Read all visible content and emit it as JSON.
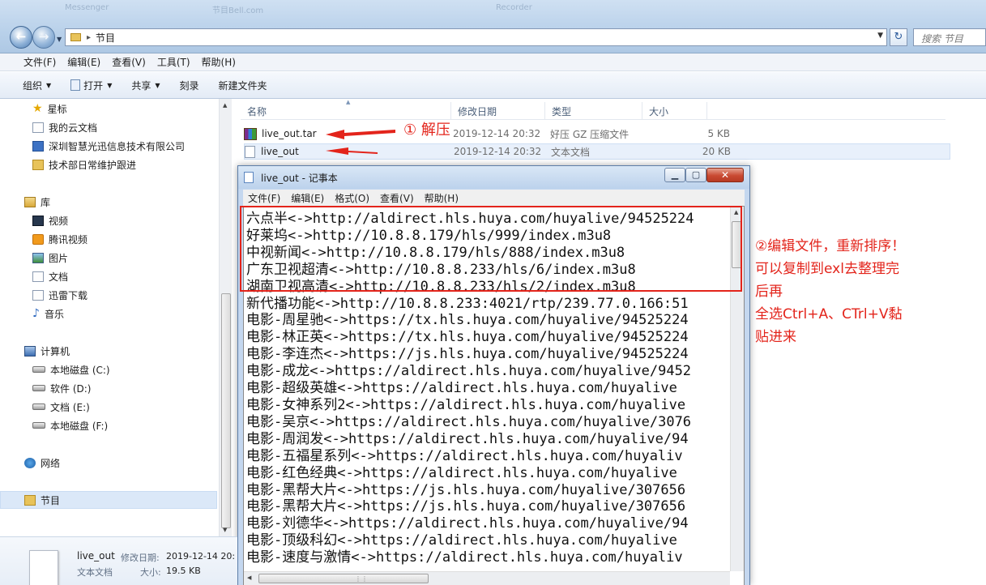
{
  "window": {
    "ghost_titles": [
      "Messenger",
      "节目Bell.com",
      "Recorder"
    ],
    "address": {
      "crumb": "节目"
    },
    "search_placeholder": "搜索 节目"
  },
  "menu": [
    "文件(F)",
    "编辑(E)",
    "查看(V)",
    "工具(T)",
    "帮助(H)"
  ],
  "toolbar": {
    "organize": "组织",
    "open": "打开",
    "share": "共享",
    "burn": "刻录",
    "new_folder": "新建文件夹"
  },
  "nav": {
    "favorites": "星标",
    "cloud_docs": "我的云文档",
    "company": "深圳智慧光迅信息技术有限公司",
    "tech_log": "技术部日常维护跟进",
    "library": "库",
    "videos": "视频",
    "tencent_video": "腾讯视频",
    "pictures": "图片",
    "documents": "文档",
    "thunder": "迅雷下载",
    "music": "音乐",
    "computer": "计算机",
    "drive_c": "本地磁盘 (C:)",
    "drive_d": "软件 (D:)",
    "drive_e": "文档 (E:)",
    "drive_f": "本地磁盘 (F:)",
    "network": "网络",
    "current_folder": "节目"
  },
  "columns": {
    "name": "名称",
    "date": "修改日期",
    "type": "类型",
    "size": "大小"
  },
  "files": [
    {
      "name": "live_out.tar",
      "date": "2019-12-14 20:32",
      "type": "好压 GZ 压缩文件",
      "size": "5 KB"
    },
    {
      "name": "live_out",
      "date": "2019-12-14 20:32",
      "type": "文本文档",
      "size": "20 KB"
    }
  ],
  "annotations": {
    "step1": "① 解压",
    "step2_lines": [
      "②编辑文件，重新排序！",
      "可以复制到exl去整理完",
      "后再",
      "全选Ctrl+A、CTrl+V黏",
      "贴进来"
    ]
  },
  "colors": {
    "annotation_red": "#e3241b"
  },
  "notepad": {
    "title": "live_out - 记事本",
    "menu": [
      "文件(F)",
      "编辑(E)",
      "格式(O)",
      "查看(V)",
      "帮助(H)"
    ],
    "close_icon": "close-icon",
    "lines": [
      "六点半<->http://aldirect.hls.huya.com/huyalive/94525224",
      "好莱坞<->http://10.8.8.179/hls/999/index.m3u8",
      "中视新闻<->http://10.8.8.179/hls/888/index.m3u8",
      "广东卫视超清<->http://10.8.8.233/hls/6/index.m3u8",
      "湖南卫视高清<->http://10.8.8.233/hls/2/index.m3u8",
      "新代播功能<->http://10.8.8.233:4021/rtp/239.77.0.166:51",
      "电影-周星驰<->https://tx.hls.huya.com/huyalive/94525224",
      "电影-林正英<->https://tx.hls.huya.com/huyalive/94525224",
      "电影-李连杰<->https://js.hls.huya.com/huyalive/94525224",
      "电影-成龙<->https://aldirect.hls.huya.com/huyalive/9452",
      "电影-超级英雄<->https://aldirect.hls.huya.com/huyalive",
      "电影-女神系列2<->https://aldirect.hls.huya.com/huyalive",
      "电影-吴京<->https://aldirect.hls.huya.com/huyalive/3076",
      "电影-周润发<->https://aldirect.hls.huya.com/huyalive/94",
      "电影-五福星系列<->https://aldirect.hls.huya.com/huyaliv",
      "电影-红色经典<->https://aldirect.hls.huya.com/huyalive",
      "电影-黑帮大片<->https://js.hls.huya.com/huyalive/307656",
      "电影-黑帮大片<->https://js.hls.huya.com/huyalive/307656",
      "电影-刘德华<->https://aldirect.hls.huya.com/huyalive/94",
      "电影-顶级科幻<->https://aldirect.hls.huya.com/huyalive",
      "电影-速度与激情<->https://aldirect.hls.huya.com/huyaliv"
    ]
  },
  "details": {
    "name": "live_out",
    "modified_label": "修改日期:",
    "modified_value": "2019-12-14 20:",
    "type": "文本文档",
    "size_label": "大小:",
    "size_value": "19.5 KB"
  }
}
